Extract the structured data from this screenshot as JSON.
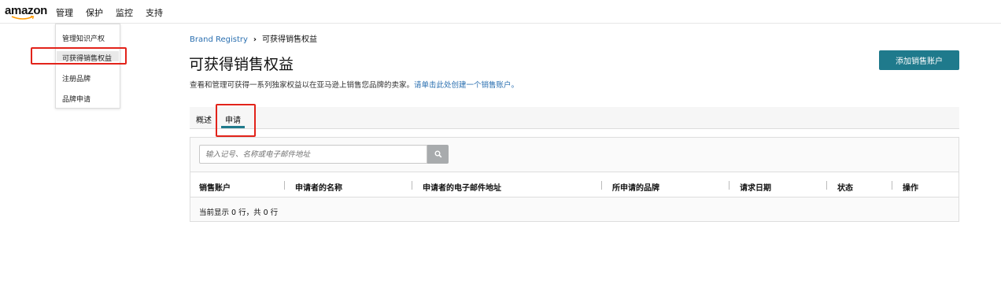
{
  "nav": {
    "logo": "amazon",
    "items": [
      "管理",
      "保护",
      "监控",
      "支持"
    ]
  },
  "dropdown": {
    "items": [
      "管理知识产权",
      "可获得销售权益",
      "注册品牌",
      "品牌申请"
    ]
  },
  "breadcrumb": {
    "root": "Brand Registry",
    "separator": "›",
    "current": "可获得销售权益"
  },
  "page": {
    "title": "可获得销售权益",
    "description": "查看和管理可获得一系列独家权益以在亚马逊上销售您品牌的卖家。",
    "description_link": "请单击此处创建一个销售账户。",
    "add_button": "添加销售账户"
  },
  "tabs": [
    "概述",
    "申请"
  ],
  "search": {
    "placeholder": "输入记号、名称或电子邮件地址"
  },
  "table": {
    "columns": [
      "销售账户",
      "申请者的名称",
      "申请者的电子邮件地址",
      "所申请的品牌",
      "请求日期",
      "状态",
      "操作"
    ],
    "row_count_text": "当前显示 0 行，共 0 行"
  },
  "colors": {
    "accent": "#1f7a8c",
    "link": "#2a6fb0",
    "highlight_border": "#e2231a"
  },
  "icons": {
    "search": "search-icon",
    "chevron": "breadcrumb-chevron-icon"
  }
}
